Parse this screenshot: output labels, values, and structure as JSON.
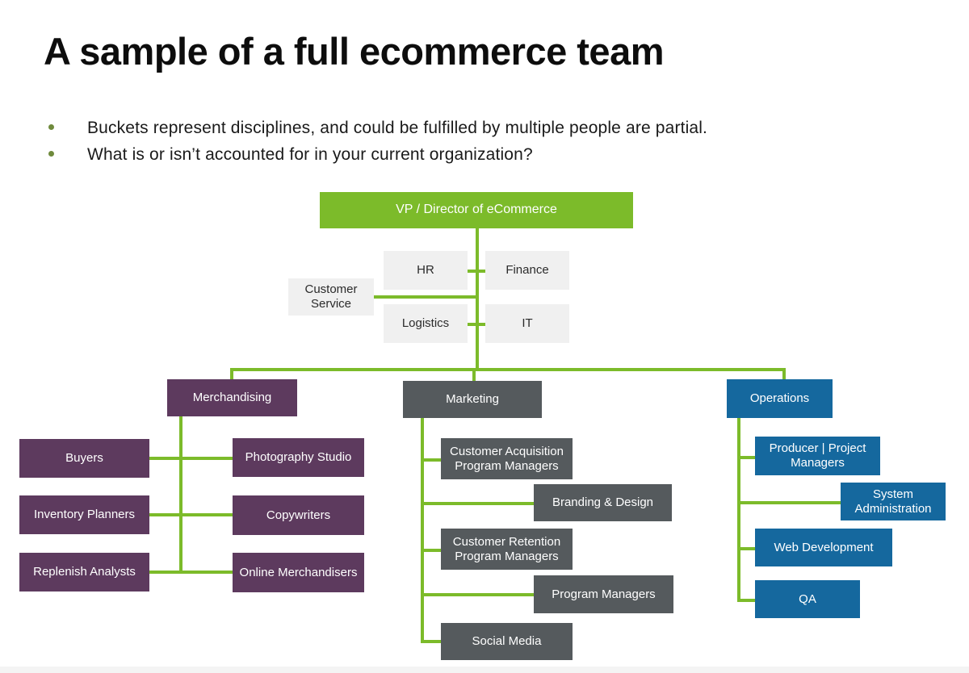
{
  "slide": {
    "title": "A sample of a full ecommerce team",
    "bullets": [
      "Buckets represent disciplines, and could be fulfilled by multiple people are partial.",
      "What is or isn’t accounted for in your current organization?"
    ]
  },
  "colors": {
    "green": "#7cbb2a",
    "light_gray": "#f0f0f0",
    "purple": "#5d3a5e",
    "slate": "#555a5d",
    "blue": "#15689e",
    "bullet_dot": "#6f8a3c",
    "title_text": "#0d0d0d",
    "background": "#ffffff"
  },
  "chart_data": {
    "type": "diagram",
    "subtype": "org-chart",
    "title": "A sample of a full ecommerce team",
    "root": {
      "label": "VP / Director of eCommerce",
      "color": "#7cbb2a",
      "text_color": "#ffffff"
    },
    "support_functions": {
      "color": "#f0f0f0",
      "text_color": "#2b2b2b",
      "nodes": [
        {
          "label": "Customer Service",
          "side": "left-outer"
        },
        {
          "label": "HR",
          "side": "left"
        },
        {
          "label": "Finance",
          "side": "right"
        },
        {
          "label": "Logistics",
          "side": "left"
        },
        {
          "label": "IT",
          "side": "right"
        }
      ]
    },
    "branches": [
      {
        "name": "Merchandising",
        "color": "#5d3a5e",
        "text_color": "#ffffff",
        "left_children": [
          "Buyers",
          "Inventory Planners",
          "Replenish Analysts"
        ],
        "right_children": [
          "Photography Studio",
          "Copywriters",
          "Online Merchandisers"
        ]
      },
      {
        "name": "Marketing",
        "color": "#555a5d",
        "text_color": "#ffffff",
        "children": [
          "Customer Acquisition Program Managers",
          "Branding & Design",
          "Customer Retention Program Managers",
          "Program Managers",
          "Social Media"
        ]
      },
      {
        "name": "Operations",
        "color": "#15689e",
        "text_color": "#ffffff",
        "children": [
          "Producer | Project Managers",
          "System Administration",
          "Web Development",
          "QA"
        ]
      }
    ],
    "connector_color": "#7cbb2a",
    "legend": null,
    "grid": false
  },
  "nodes": {
    "vp": "VP / Director of eCommerce",
    "customer_service": "Customer Service",
    "hr": "HR",
    "finance": "Finance",
    "logistics": "Logistics",
    "it": "IT",
    "merchandising": "Merchandising",
    "buyers": "Buyers",
    "inventory_planners": "Inventory Planners",
    "replenish_analysts": "Replenish Analysts",
    "photography_studio": "Photography Studio",
    "copywriters": "Copywriters",
    "online_merchandisers": "Online Merchandisers",
    "marketing": "Marketing",
    "customer_acquisition_pm": "Customer Acquisition Program Managers",
    "branding_design": "Branding & Design",
    "customer_retention_pm": "Customer Retention Program Managers",
    "program_managers": "Program Managers",
    "social_media": "Social Media",
    "operations": "Operations",
    "producer_project_managers": "Producer | Project Managers",
    "system_administration": "System Administration",
    "web_development": "Web Development",
    "qa": "QA"
  }
}
